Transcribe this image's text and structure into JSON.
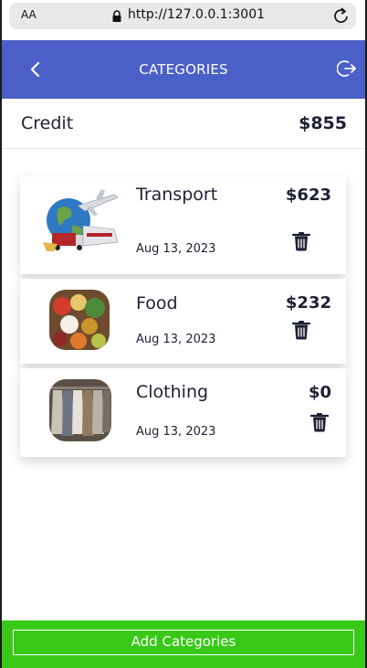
{
  "browser": {
    "text_size": "AA",
    "url": "http://127.0.0.1:3001"
  },
  "header": {
    "title": "CATEGORIES"
  },
  "credit": {
    "label": "Credit",
    "value": "$855"
  },
  "categories": [
    {
      "name": "Transport",
      "amount": "$623",
      "date": "Aug 13, 2023"
    },
    {
      "name": "Food",
      "amount": "$232",
      "date": "Aug 13, 2023"
    },
    {
      "name": "Clothing",
      "amount": "$0",
      "date": "Aug 13, 2023"
    }
  ],
  "footer": {
    "add_label": "Add Categories"
  },
  "colors": {
    "header": "#4a5fc7",
    "footer": "#38c918",
    "text": "#1e2133"
  }
}
